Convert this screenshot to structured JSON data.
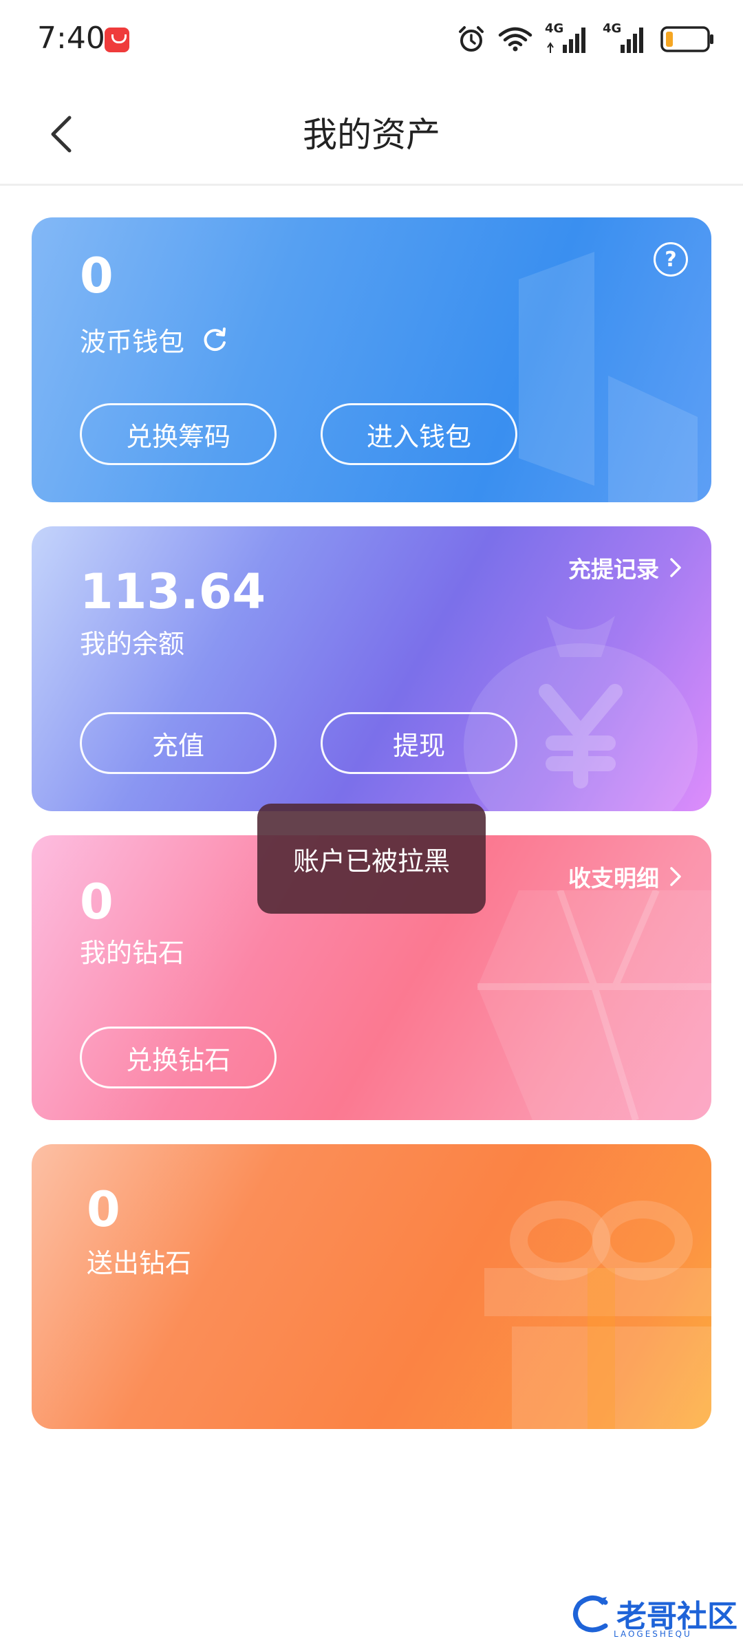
{
  "status_bar": {
    "time": "7:40",
    "icons": [
      "huawei-appgallery-icon",
      "alarm-icon",
      "wifi-icon",
      "signal-4g-icon",
      "signal-4g-icon",
      "battery-icon"
    ],
    "network_labels": [
      "4G",
      "4G"
    ]
  },
  "header": {
    "title": "我的资产",
    "back_icon": "chevron-left-icon"
  },
  "cards": {
    "wallet": {
      "value": "0",
      "label": "波币钱包",
      "refresh_icon": "refresh-icon",
      "help_icon": "question-icon",
      "buttons": [
        "兑换筹码",
        "进入钱包"
      ],
      "color": "#3a8ff0"
    },
    "balance": {
      "value": "113.64",
      "label": "我的余额",
      "link": "充提记录",
      "buttons": [
        "充值",
        "提现"
      ],
      "color": "#7b70ea"
    },
    "diamond": {
      "value": "0",
      "label": "我的钻石",
      "link": "收支明细",
      "buttons": [
        "兑换钻石"
      ],
      "color": "#fb7991"
    },
    "sent": {
      "value": "0",
      "label": "送出钻石",
      "color": "#fb8344"
    }
  },
  "toast": {
    "text": "账户已被拉黑"
  },
  "watermark": {
    "text": "老哥社区",
    "subtext": "LAOGESHEQU"
  }
}
